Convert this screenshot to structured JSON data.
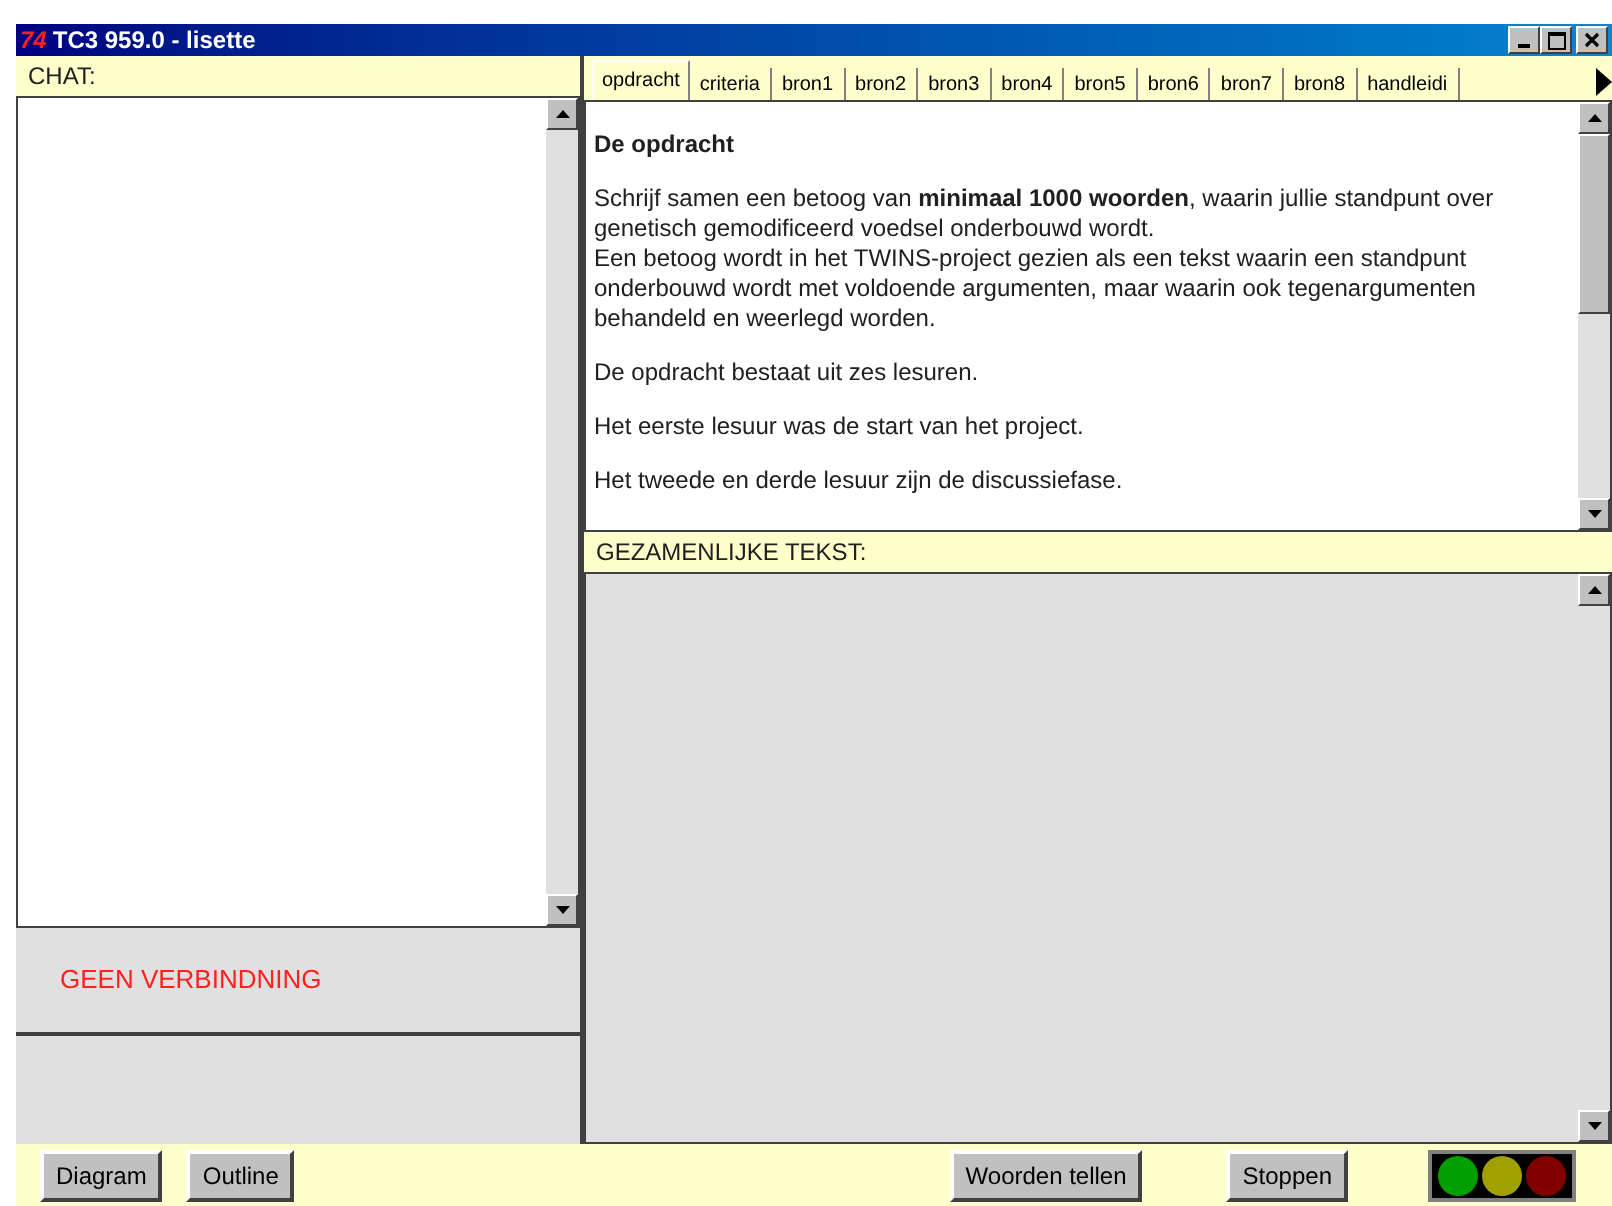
{
  "window": {
    "title": "TC3 959.0 - lisette",
    "logo": "74"
  },
  "chat": {
    "label": "CHAT:",
    "status": "GEEN VERBINDNING"
  },
  "tabs": [
    {
      "label": "opdracht",
      "selected": true
    },
    {
      "label": "criteria",
      "selected": false
    },
    {
      "label": "bron1",
      "selected": false
    },
    {
      "label": "bron2",
      "selected": false
    },
    {
      "label": "bron3",
      "selected": false
    },
    {
      "label": "bron4",
      "selected": false
    },
    {
      "label": "bron5",
      "selected": false
    },
    {
      "label": "bron6",
      "selected": false
    },
    {
      "label": "bron7",
      "selected": false
    },
    {
      "label": "bron8",
      "selected": false
    },
    {
      "label": "handleidi",
      "selected": false
    }
  ],
  "assignment": {
    "heading": "De opdracht",
    "blocks": [
      [
        "Schrijf samen een betoog van **minimaal 1000 woorden**, waarin jullie standpunt over genetisch gemodificeerd voedsel onderbouwd wordt.",
        "Een betoog wordt in het TWINS-project gezien als een tekst waarin een standpunt onderbouwd wordt met voldoende argumenten, maar waarin ook tegenargumenten behandeld en weerlegd worden."
      ],
      [
        "De opdracht bestaat uit zes lesuren."
      ],
      [
        "Het eerste lesuur was de start van het project."
      ],
      [
        "Het tweede en derde lesuur zijn de discussiefase."
      ]
    ]
  },
  "shared_text": {
    "label": "GEZAMENLIJKE TEKST:"
  },
  "buttons_left": [
    "Diagram",
    "Outline"
  ],
  "buttons_right": [
    "Woorden tellen",
    "Stoppen"
  ],
  "lights": [
    {
      "color": "#00a000"
    },
    {
      "color": "#a0a000"
    },
    {
      "color": "#800000"
    }
  ]
}
